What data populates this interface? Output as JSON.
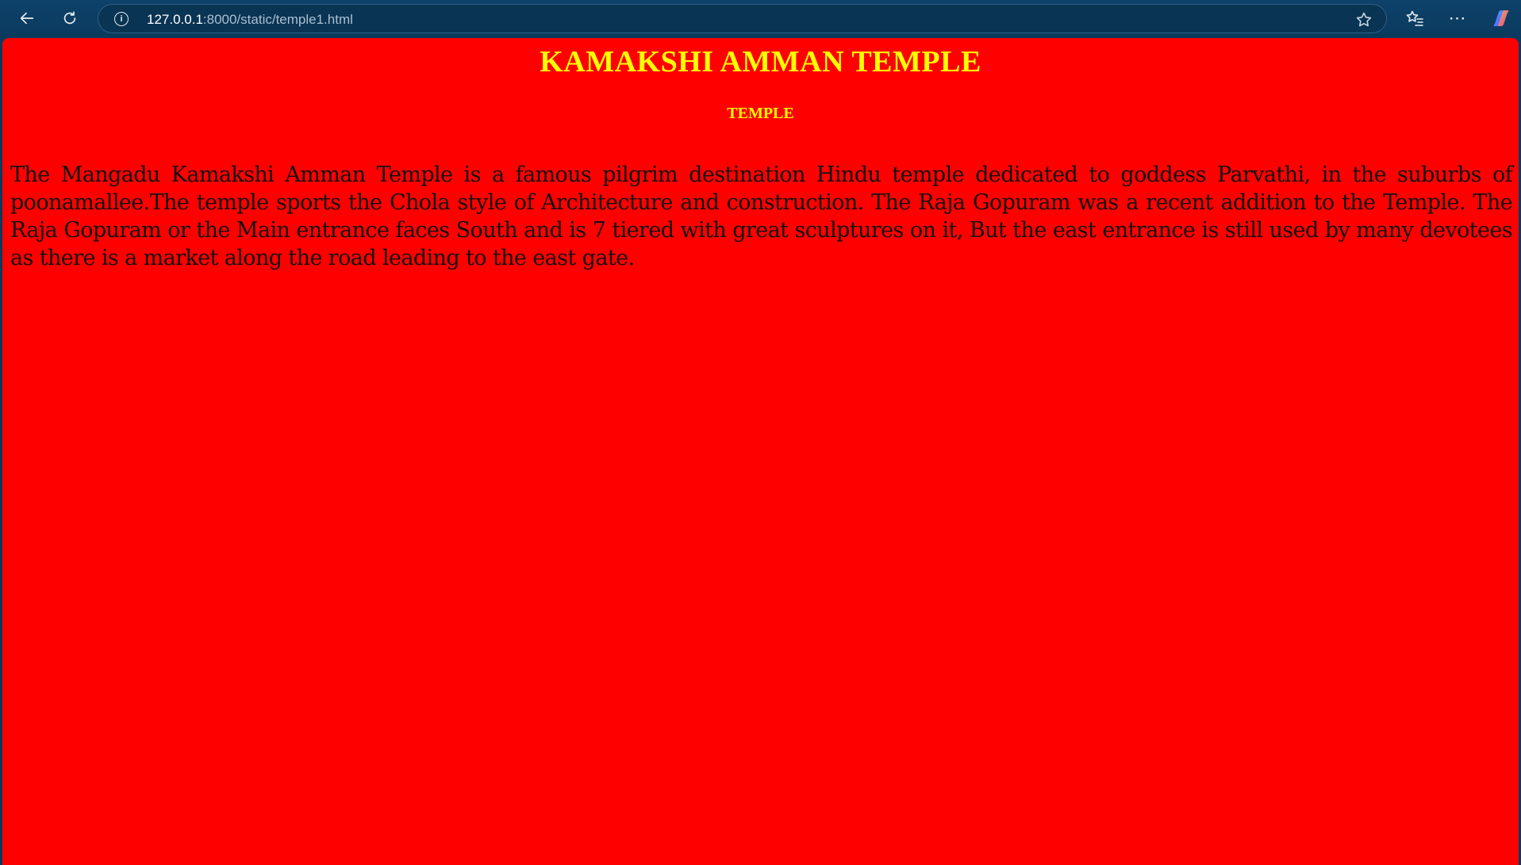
{
  "browser": {
    "url_host": "127.0.0.1",
    "url_path": ":8000/static/temple1.html",
    "back_icon": "arrow-left-icon",
    "reload_icon": "reload-icon",
    "info_icon": "info-icon",
    "favorite_icon": "star-icon",
    "favorites_icon": "favorites-icon",
    "more_icon": "more-icon",
    "copilot_icon": "copilot-icon"
  },
  "page": {
    "title": "KAMAKSHI AMMAN TEMPLE",
    "subtitle": "TEMPLE",
    "paragraph": "The Mangadu Kamakshi Amman Temple is a famous pilgrim destination Hindu temple dedicated to goddess Parvathi, in the suburbs of poonamallee.The temple sports the Chola style of Architecture and construction. The Raja Gopuram was a recent addition to the Temple. The Raja Gopuram or the Main entrance faces South and is 7 tiered with great sculptures on it, But the east entrance is still used by many devotees as there is a market along the road leading to the east gate.",
    "background_color": "#ff0000",
    "heading_color": "#ffff00"
  }
}
